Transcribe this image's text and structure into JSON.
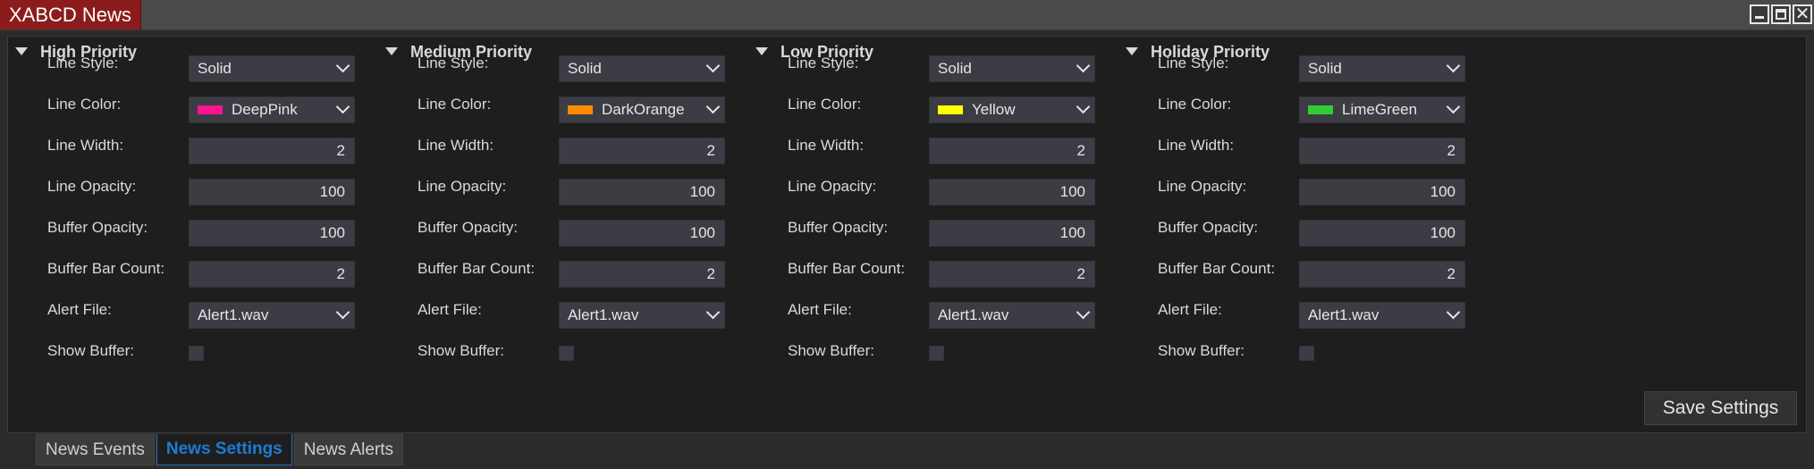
{
  "window": {
    "title": "XABCD News",
    "buttons": {
      "minimize": "",
      "maximize": "",
      "close": "✕"
    }
  },
  "labels": {
    "line_style": "Line Style:",
    "line_color": "Line Color:",
    "line_width": "Line Width:",
    "line_opacity": "Line Opacity:",
    "buffer_opacity": "Buffer Opacity:",
    "buffer_bar_count": "Buffer Bar Count:",
    "alert_file": "Alert File:",
    "show_buffer": "Show Buffer:"
  },
  "sections": [
    {
      "title": "High Priority",
      "line_style": "Solid",
      "line_color": "DeepPink",
      "swatch": "#ff1493",
      "line_width": "2",
      "line_opacity": "100",
      "buffer_opacity": "100",
      "buffer_bar_count": "2",
      "alert_file": "Alert1.wav",
      "show_buffer": false
    },
    {
      "title": "Medium Priority",
      "line_style": "Solid",
      "line_color": "DarkOrange",
      "swatch": "#ff8c00",
      "line_width": "2",
      "line_opacity": "100",
      "buffer_opacity": "100",
      "buffer_bar_count": "2",
      "alert_file": "Alert1.wav",
      "show_buffer": false
    },
    {
      "title": "Low Priority",
      "line_style": "Solid",
      "line_color": "Yellow",
      "swatch": "#ffff00",
      "line_width": "2",
      "line_opacity": "100",
      "buffer_opacity": "100",
      "buffer_bar_count": "2",
      "alert_file": "Alert1.wav",
      "show_buffer": false
    },
    {
      "title": "Holiday Priority",
      "line_style": "Solid",
      "line_color": "LimeGreen",
      "swatch": "#32cd32",
      "line_width": "2",
      "line_opacity": "100",
      "buffer_opacity": "100",
      "buffer_bar_count": "2",
      "alert_file": "Alert1.wav",
      "show_buffer": false
    }
  ],
  "save_button": "Save Settings",
  "tabs": [
    {
      "label": "News Events",
      "active": false
    },
    {
      "label": "News Settings",
      "active": true
    },
    {
      "label": "News Alerts",
      "active": false
    }
  ]
}
